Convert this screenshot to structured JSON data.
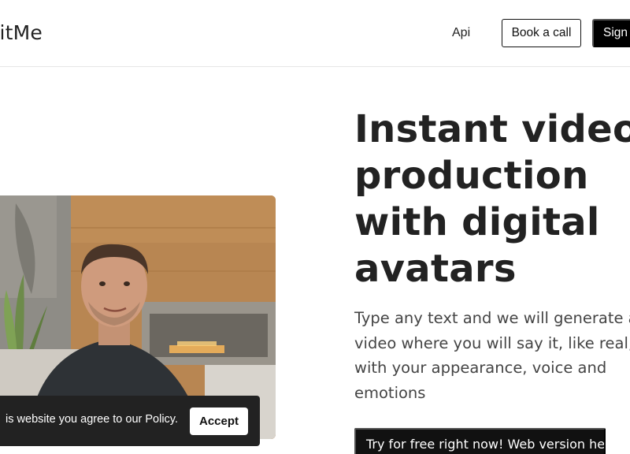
{
  "header": {
    "logo": "ritMe",
    "nav_api": "Api",
    "book_call": "Book a call",
    "sign": "Sign"
  },
  "hero": {
    "title_lines": [
      "Instant video",
      "production",
      "with digital",
      "avatars"
    ],
    "desc_lines": [
      "Type any text and we will generate a",
      "video where you will say it, like real,",
      "with your appearance, voice and",
      "emotions"
    ],
    "cta": "Try for free right now! Web version here"
  },
  "cookie": {
    "text": "is website you agree to our Policy.",
    "accept": "Accept"
  },
  "colors": {
    "primary": "#111111",
    "text": "#222222",
    "muted": "#444444",
    "cookie_bg": "#222222"
  }
}
